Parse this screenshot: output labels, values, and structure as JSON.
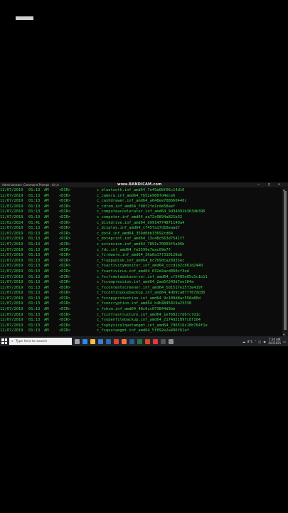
{
  "window": {
    "title": "Administrator: Command Prompt - dir /s",
    "watermark": "www.BANDICAM.com",
    "min_symbol": "–",
    "max_symbol": "□",
    "close_symbol": "✕"
  },
  "listing": {
    "rows": [
      {
        "date": "12/07/2019",
        "time": "01:13",
        "ampm": "AM",
        "type": "<DIR>",
        "name": "c_bluetooth.inf_amd64_7e49a68f06c14d10"
      },
      {
        "date": "12/07/2019",
        "time": "01:13",
        "ampm": "AM",
        "type": "<DIR>",
        "name": "c_camera.inf_amd64_7b52e960fd4ece6"
      },
      {
        "date": "12/07/2019",
        "time": "01:13",
        "ampm": "AM",
        "type": "<DIR>",
        "name": "c_cashdrawer.inf_amd64_a648ee708660440c"
      },
      {
        "date": "12/07/2019",
        "time": "01:13",
        "ampm": "AM",
        "type": "<DIR>",
        "name": "c_cdrom.inf_amd64_f08f2fe1cde58aef"
      },
      {
        "date": "12/07/2019",
        "time": "01:13",
        "ampm": "AM",
        "type": "<DIR>",
        "name": "c_computeaccelerator.inf_amd64_9d34992b3634b396"
      },
      {
        "date": "12/07/2019",
        "time": "01:13",
        "ampm": "AM",
        "type": "<DIR>",
        "name": "c_computer.inf_amd64_aa72c0894a821b32"
      },
      {
        "date": "12/02/2024",
        "time": "01:41",
        "ampm": "AM",
        "type": "<DIR>",
        "name": "c_diskdrive.inf_amd64_b9914774871140a4"
      },
      {
        "date": "12/07/2019",
        "time": "01:13",
        "ampm": "AM",
        "type": "<DIR>",
        "name": "c_display.inf_amd64_c7457a17d16eaadf"
      },
      {
        "date": "12/07/2019",
        "time": "01:13",
        "ampm": "AM",
        "type": "<DIR>",
        "name": "c_dot4.inf_amd64_359d0bb33692cd84"
      },
      {
        "date": "12/07/2019",
        "time": "01:13",
        "ampm": "AM",
        "type": "<DIR>",
        "name": "c_dot4print.inf_amd64_13c48c563d7541f7"
      },
      {
        "date": "12/07/2019",
        "time": "01:13",
        "ampm": "AM",
        "type": "<DIR>",
        "name": "c_extension.inf_amd64_7891c70003f5a96b"
      },
      {
        "date": "12/07/2019",
        "time": "01:13",
        "ampm": "AM",
        "type": "<DIR>",
        "name": "c_fdc.inf_amd64_fe3599e7eac09e7f"
      },
      {
        "date": "12/07/2019",
        "time": "01:13",
        "ampm": "AM",
        "type": "<DIR>",
        "name": "c_firmware.inf_amd64_36a6a17f310128ab"
      },
      {
        "date": "12/07/2019",
        "time": "01:13",
        "ampm": "AM",
        "type": "<DIR>",
        "name": "c_floppydisk.inf_amd64_bc7b9dca28933ec"
      },
      {
        "date": "12/07/2019",
        "time": "01:13",
        "ampm": "AM",
        "type": "<DIR>",
        "name": "c_fsactivitymonitor.inf_amd64_cccd1b2cb61d2440"
      },
      {
        "date": "12/07/2019",
        "time": "01:13",
        "ampm": "AM",
        "type": "<DIR>",
        "name": "c_fsantivirus.inf_amd64_632d2acd060cf3ed"
      },
      {
        "date": "12/07/2019",
        "time": "01:13",
        "ampm": "AM",
        "type": "<DIR>",
        "name": "c_fscfsmetadataserver.inf_amd64_cf5485e05c5c1b11"
      },
      {
        "date": "12/07/2019",
        "time": "01:13",
        "ampm": "AM",
        "type": "<DIR>",
        "name": "c_fscompression.inf_amd64_2aa5f249d7ee104a"
      },
      {
        "date": "12/07/2019",
        "time": "01:13",
        "ampm": "AM",
        "type": "<DIR>",
        "name": "c_fscontentscreener.inf_amd64_bd1517e25f3e419f"
      },
      {
        "date": "12/07/2019",
        "time": "01:13",
        "ampm": "AM",
        "type": "<DIR>",
        "name": "c_fscontinuousbackup.inf_amd64_4db9ca877f67dd36"
      },
      {
        "date": "12/07/2019",
        "time": "01:13",
        "ampm": "AM",
        "type": "<DIR>",
        "name": "c_fscopyprotection.inf_amd64_9c100d8ac558a80d"
      },
      {
        "date": "12/07/2019",
        "time": "01:13",
        "ampm": "AM",
        "type": "<DIR>",
        "name": "c_fsencryption.inf_amd64_b4b4845819a23338"
      },
      {
        "date": "12/07/2019",
        "time": "01:13",
        "ampm": "AM",
        "type": "<DIR>",
        "name": "c_fshsm.inf_amd64_48c6cc073844d3bb"
      },
      {
        "date": "12/07/2019",
        "time": "01:13",
        "ampm": "AM",
        "type": "<DIR>",
        "name": "c_fsinfrastructure.inf_amd64_1ef602cfd6fc7d1c"
      },
      {
        "date": "12/07/2019",
        "time": "01:13",
        "ampm": "AM",
        "type": "<DIR>",
        "name": "c_fsopenfilebackup.inf_amd64_2174d2189fc8f164"
      },
      {
        "date": "12/07/2019",
        "time": "01:13",
        "ampm": "AM",
        "type": "<DIR>",
        "name": "c_fsphysicalquotamgmt.inf_amd64_796516c18b764f1e"
      },
      {
        "date": "12/07/2019",
        "time": "01:13",
        "ampm": "AM",
        "type": "<DIR>",
        "name": "c_fsquotamgmt.inf_amd64_5f092e2a496f61af"
      }
    ]
  },
  "taskbar": {
    "search_placeholder": "Type here to search",
    "search_icon": "search-icon",
    "pinned_icons": [
      {
        "name": "task-view-icon",
        "color": "#9aa0a6"
      },
      {
        "name": "edge-icon",
        "color": "#2d89ef"
      },
      {
        "name": "file-explorer-icon",
        "color": "#f3c13a"
      },
      {
        "name": "store-icon",
        "color": "#3a7bd5"
      },
      {
        "name": "mail-icon",
        "color": "#2b6cb0"
      },
      {
        "name": "chrome-icon",
        "color": "#db4437"
      },
      {
        "name": "firefox-icon",
        "color": "#ff7139"
      },
      {
        "name": "word-icon",
        "color": "#2b579a"
      },
      {
        "name": "excel-icon",
        "color": "#217346"
      },
      {
        "name": "powerpoint-icon",
        "color": "#d24726"
      },
      {
        "name": "bandicam-icon",
        "color": "#e53935"
      },
      {
        "name": "cmd-icon",
        "color": "#555555"
      },
      {
        "name": "settings-icon",
        "color": "#8e8e8e"
      }
    ],
    "temperature": "8°C",
    "time": "7:20 AM",
    "date": "2/4/2025"
  }
}
